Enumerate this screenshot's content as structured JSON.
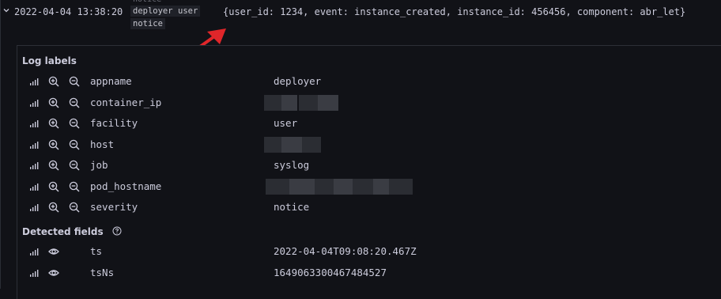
{
  "log_line": {
    "timestamp": "2022-04-04 13:38:20",
    "labels": [
      "deployer",
      "user",
      "notice"
    ],
    "message": "{user_id: 1234, event: instance_created, instance_id: 456456, component: abr_let}"
  },
  "details": {
    "log_labels_title": "Log labels",
    "log_labels": [
      {
        "name": "appname",
        "value": "deployer"
      },
      {
        "name": "container_ip",
        "value": ""
      },
      {
        "name": "facility",
        "value": "user"
      },
      {
        "name": "host",
        "value": ""
      },
      {
        "name": "job",
        "value": "syslog"
      },
      {
        "name": "pod_hostname",
        "value": ""
      },
      {
        "name": "severity",
        "value": "notice"
      }
    ],
    "detected_fields_title": "Detected fields",
    "detected_fields": [
      {
        "name": "ts",
        "value": "2022-04-04T09:08:20.467Z"
      },
      {
        "name": "tsNs",
        "value": "1649063300467484527"
      }
    ]
  },
  "icons": {
    "stats": "bar-chart-icon",
    "filter_for": "zoom-in-icon",
    "filter_out": "zoom-out-icon",
    "toggle_field": "eye-icon",
    "help": "question-circle-icon"
  },
  "colors": {
    "background": "#111217",
    "text": "#ccccdc",
    "arrow": "#e0262a"
  }
}
